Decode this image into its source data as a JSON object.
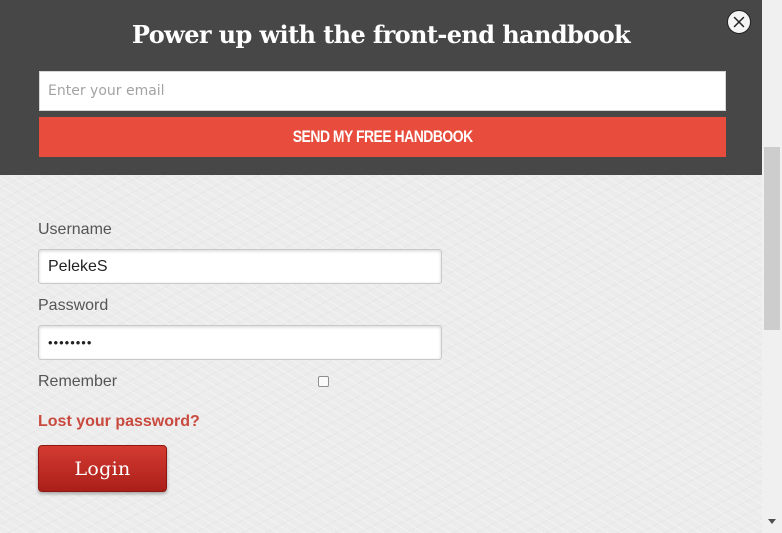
{
  "promo": {
    "title": "Power up with the front-end handbook",
    "email_placeholder": "Enter your email",
    "submit_label": "SEND MY FREE HANDBOOK",
    "close_icon": "close-circle-icon",
    "colors": {
      "background": "#474747",
      "button": "#e74c3c"
    }
  },
  "login_form": {
    "username_label": "Username",
    "username_value": "PelekeS",
    "password_label": "Password",
    "password_value": "••••••••",
    "remember_label": "Remember",
    "remember_checked": false,
    "lost_password_link": "Lost your password?",
    "login_button": "Login",
    "colors": {
      "link": "#c9493e",
      "button": "#c0302a"
    }
  }
}
